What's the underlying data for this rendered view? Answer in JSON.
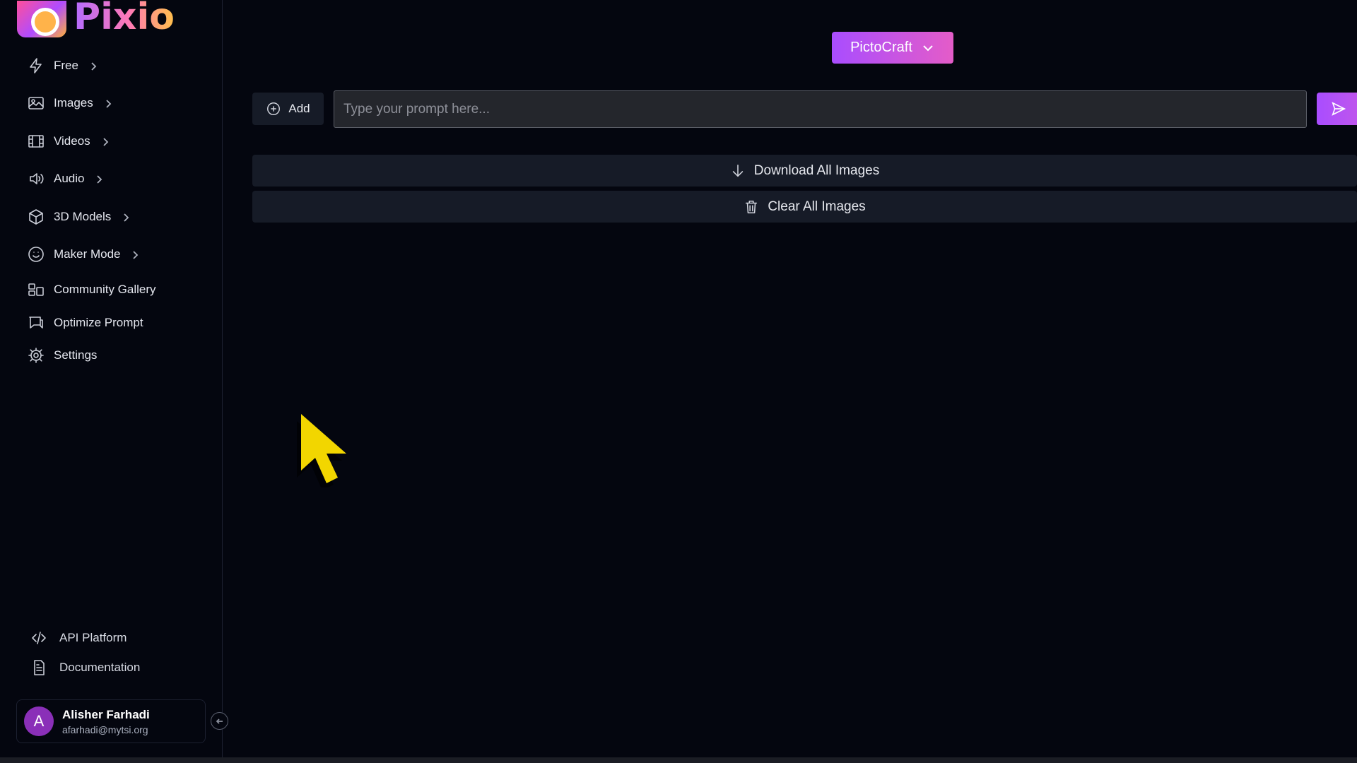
{
  "brand": {
    "name": "Pixio"
  },
  "sidebar": {
    "items": [
      {
        "label": "Free",
        "icon": "lightning-icon",
        "has_chevron": true
      },
      {
        "label": "Images",
        "icon": "image-icon",
        "has_chevron": true
      },
      {
        "label": "Videos",
        "icon": "film-icon",
        "has_chevron": true
      },
      {
        "label": "Audio",
        "icon": "speaker-icon",
        "has_chevron": true
      },
      {
        "label": "3D Models",
        "icon": "cube-icon",
        "has_chevron": true
      },
      {
        "label": "Maker Mode",
        "icon": "smile-icon",
        "has_chevron": true
      },
      {
        "label": "Community Gallery",
        "icon": "gallery-icon",
        "has_chevron": false
      },
      {
        "label": "Optimize Prompt",
        "icon": "chat-icon",
        "has_chevron": false
      },
      {
        "label": "Settings",
        "icon": "gear-icon",
        "has_chevron": false
      }
    ],
    "bottom_links": [
      {
        "label": "API Platform",
        "icon": "code-icon"
      },
      {
        "label": "Documentation",
        "icon": "document-icon"
      }
    ],
    "user": {
      "initial": "A",
      "name": "Alisher Farhadi",
      "email": "afarhadi@mytsi.org"
    }
  },
  "toolbar": {
    "model_label": "PictoCraft",
    "add_label": "Add",
    "prompt": {
      "value": "",
      "placeholder": "Type your prompt here..."
    }
  },
  "actions": {
    "download_label": "Download All Images",
    "clear_label": "Clear All Images"
  },
  "colors": {
    "background": "#04060f",
    "accent_start": "#a94dff",
    "accent_end": "#e45cc8",
    "button_bg": "#161b27",
    "cursor": "#f2d600"
  }
}
